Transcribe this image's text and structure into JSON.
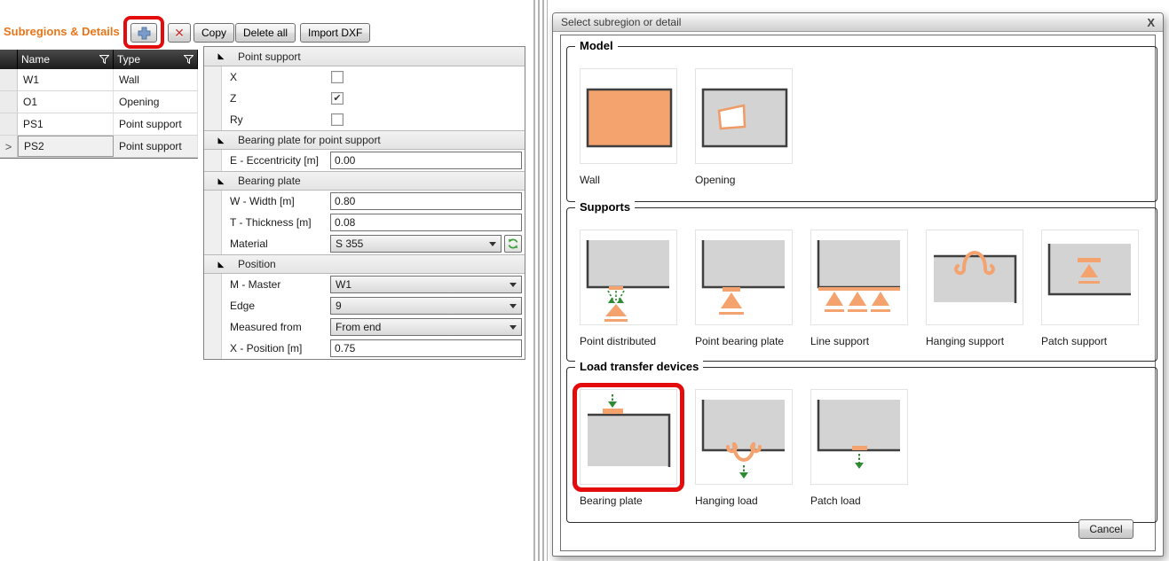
{
  "left_panel": {
    "title": "Subregions & Details",
    "toolbar": {
      "add_icon": "add",
      "delete_icon": "delete",
      "copy_label": "Copy",
      "delete_all_label": "Delete all",
      "import_dxf_label": "Import DXF"
    },
    "table": {
      "columns": {
        "name": "Name",
        "type": "Type"
      },
      "rows": [
        {
          "name": "W1",
          "type": "Wall",
          "selected": false
        },
        {
          "name": "O1",
          "type": "Opening",
          "selected": false
        },
        {
          "name": "PS1",
          "type": "Point support",
          "selected": false
        },
        {
          "name": "PS2",
          "type": "Point support",
          "selected": true
        }
      ]
    },
    "properties": {
      "sections": [
        {
          "title": "Point support",
          "rows": [
            {
              "label": "X",
              "control": "checkbox",
              "checked": false
            },
            {
              "label": "Z",
              "control": "checkbox",
              "checked": true
            },
            {
              "label": "Ry",
              "control": "checkbox",
              "checked": false
            }
          ]
        },
        {
          "title": "Bearing plate for point support",
          "rows": [
            {
              "label": "E - Eccentricity [m]",
              "control": "text",
              "value": "0.00"
            }
          ]
        },
        {
          "title": "Bearing plate",
          "rows": [
            {
              "label": "W - Width [m]",
              "control": "text",
              "value": "0.80"
            },
            {
              "label": "T - Thickness [m]",
              "control": "text",
              "value": "0.08"
            },
            {
              "label": "Material",
              "control": "dropdown",
              "value": "S 355",
              "refresh_button": true
            }
          ]
        },
        {
          "title": "Position",
          "rows": [
            {
              "label": "M - Master",
              "control": "dropdown",
              "value": "W1"
            },
            {
              "label": "Edge",
              "control": "dropdown",
              "value": "9"
            },
            {
              "label": "Measured from",
              "control": "dropdown",
              "value": "From end"
            },
            {
              "label": "X - Position [m]",
              "control": "text",
              "value": "0.75"
            }
          ]
        }
      ]
    }
  },
  "dialog": {
    "title": "Select subregion or detail",
    "close_label": "X",
    "groups": [
      {
        "title": "Model",
        "tiles": [
          {
            "label": "Wall"
          },
          {
            "label": "Opening"
          }
        ]
      },
      {
        "title": "Supports",
        "tiles": [
          {
            "label": "Point distributed"
          },
          {
            "label": "Point bearing plate"
          },
          {
            "label": "Line support"
          },
          {
            "label": "Hanging support"
          },
          {
            "label": "Patch support"
          }
        ]
      },
      {
        "title": "Load transfer devices",
        "tiles": [
          {
            "label": "Bearing plate",
            "highlighted": true
          },
          {
            "label": "Hanging load"
          },
          {
            "label": "Patch load"
          }
        ]
      }
    ],
    "cancel_label": "Cancel"
  },
  "colors": {
    "accent_orange": "#E8751A",
    "tile_fill_orange": "#F4A26E",
    "tile_fill_gray": "#D3D3D3",
    "tile_stroke_dark": "#3F3F3F",
    "arrow_green": "#2E8B32",
    "annotation_red": "#E30B0B"
  }
}
